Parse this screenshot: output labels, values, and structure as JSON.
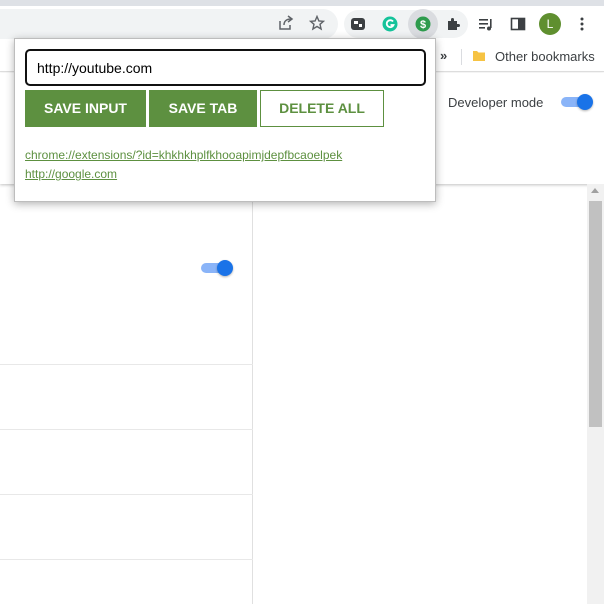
{
  "toolbar": {
    "share_icon": "share-icon",
    "bookmark_star_icon": "star-icon",
    "extensions": [
      "extension-icon-1",
      "grammarly-icon",
      "dollar-extension-icon"
    ],
    "puzzle_icon": "puzzle-icon",
    "media_icon": "media-control-icon",
    "side_panel_icon": "side-panel-icon",
    "avatar_initial": "L",
    "menu_icon": "more-vert-icon"
  },
  "bookmarks": {
    "chevron": "»",
    "other_label": "Other bookmarks"
  },
  "extensions_page": {
    "developer_mode_label": "Developer mode",
    "developer_mode_on": true,
    "extension_toggle_on": true
  },
  "popup": {
    "input_value": "http://youtube.com",
    "save_input_label": "SAVE INPUT",
    "save_tab_label": "SAVE TAB",
    "delete_all_label": "DELETE ALL",
    "links": [
      "chrome://extensions/?id=khkhkhplfkhooapimjdepfbcaoelpek",
      "http://google.com"
    ]
  },
  "colors": {
    "accent_green": "#5d9040",
    "toggle_blue": "#1a73e8"
  }
}
